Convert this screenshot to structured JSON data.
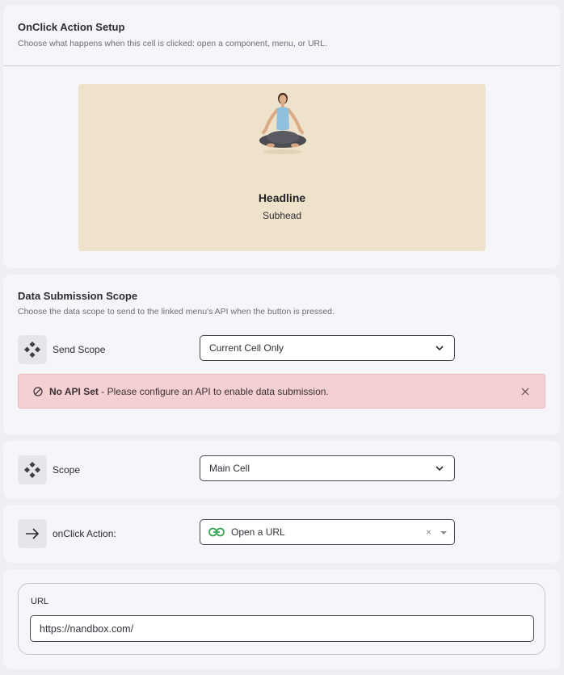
{
  "setup": {
    "title": "OnClick Action Setup",
    "description": "Choose what happens when this cell is clicked: open a component, menu, or URL.",
    "preview": {
      "headline": "Headline",
      "subhead": "Subhead",
      "background_color": "#efe2cb"
    }
  },
  "data_submission": {
    "title": "Data Submission Scope",
    "description": "Choose the data scope to send to the linked menu's API when the button is pressed.",
    "send_scope": {
      "label": "Send Scope",
      "icon": "diamond-nodes-icon",
      "selected": "Current Cell Only"
    },
    "alert": {
      "icon": "ban-icon",
      "title": "No API Set",
      "message": " - Please configure an API to enable data submission.",
      "close_icon": "close-icon",
      "color": "#f5d0d2"
    }
  },
  "scope": {
    "label": "Scope",
    "icon": "diamond-nodes-icon",
    "selected": "Main Cell"
  },
  "action": {
    "label": "onClick Action:",
    "icon": "arrow-right-icon",
    "selected": "Open a URL",
    "selected_icon": "link-icon",
    "clear": "×",
    "link_color": "#3aa655"
  },
  "url": {
    "label": "URL",
    "value": "https://nandbox.com/"
  }
}
